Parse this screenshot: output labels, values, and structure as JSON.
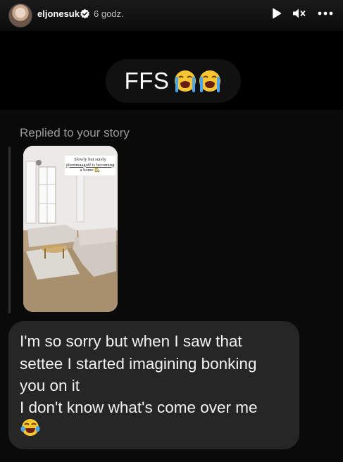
{
  "header": {
    "username": "eljonesuk",
    "time": "6 godz.",
    "icons": [
      "avatar",
      "verified-icon",
      "play-icon",
      "mute-icon",
      "more-icon"
    ]
  },
  "story": {
    "caption": "FFS",
    "caption_emoji": "loudly-crying-face x2"
  },
  "reply": {
    "label": "Replied to your story",
    "thumbnail_sticker": [
      "Slowly but surely",
      "@emmaagoff is becoming",
      "a home 🏡"
    ]
  },
  "message": {
    "lines": [
      "I'm so sorry but when I saw that",
      "settee I started imagining bonking",
      "you on it",
      "I don't know what's come over me"
    ],
    "emoji": "face-with-tears-of-joy"
  },
  "colors": {
    "background": "#000000",
    "bubble": "#262626",
    "muted_text": "#9a9a9a",
    "verified": "#ffffff"
  }
}
